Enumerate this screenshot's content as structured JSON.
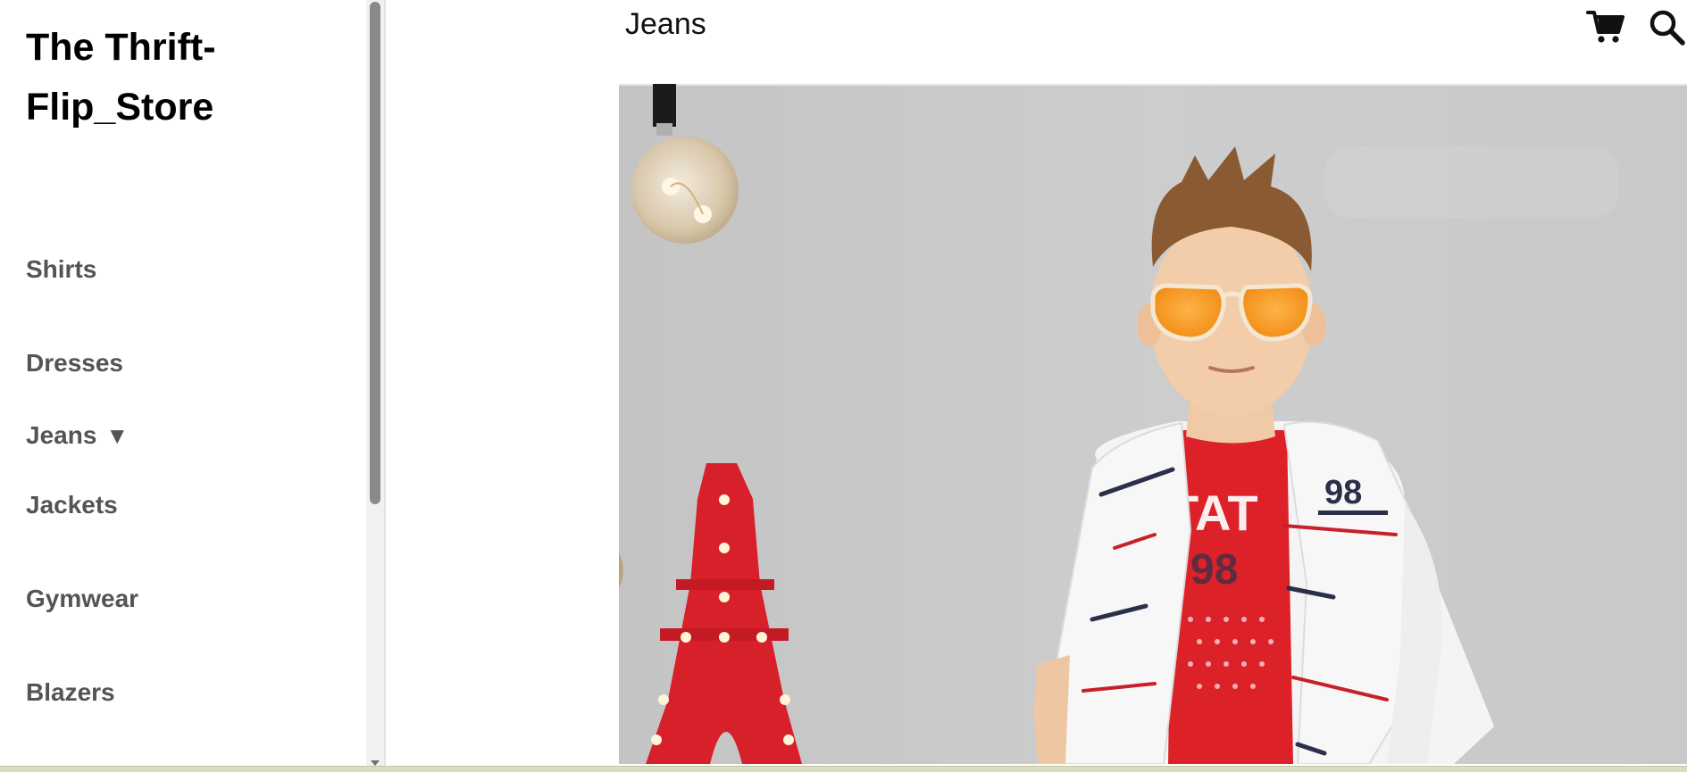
{
  "sidebar": {
    "store_name": "The Thrift-Flip_Store",
    "items": [
      {
        "label": "Shirts"
      },
      {
        "label": "Dresses"
      },
      {
        "label": "Jeans",
        "caret": "▼"
      },
      {
        "label": "Jackets"
      },
      {
        "label": "Gymwear"
      },
      {
        "label": "Blazers"
      }
    ]
  },
  "header": {
    "title": "Jeans",
    "icons": [
      "cart-icon",
      "search-icon"
    ]
  },
  "hero": {
    "image": "boy-in-white-jacket-with-sunglasses-photo",
    "jacket_badge": "98"
  },
  "colors": {
    "nav_text": "#555353",
    "title_text": "#000000",
    "hero_bg": "#c8c8c8",
    "accent_red": "#d8202a"
  }
}
